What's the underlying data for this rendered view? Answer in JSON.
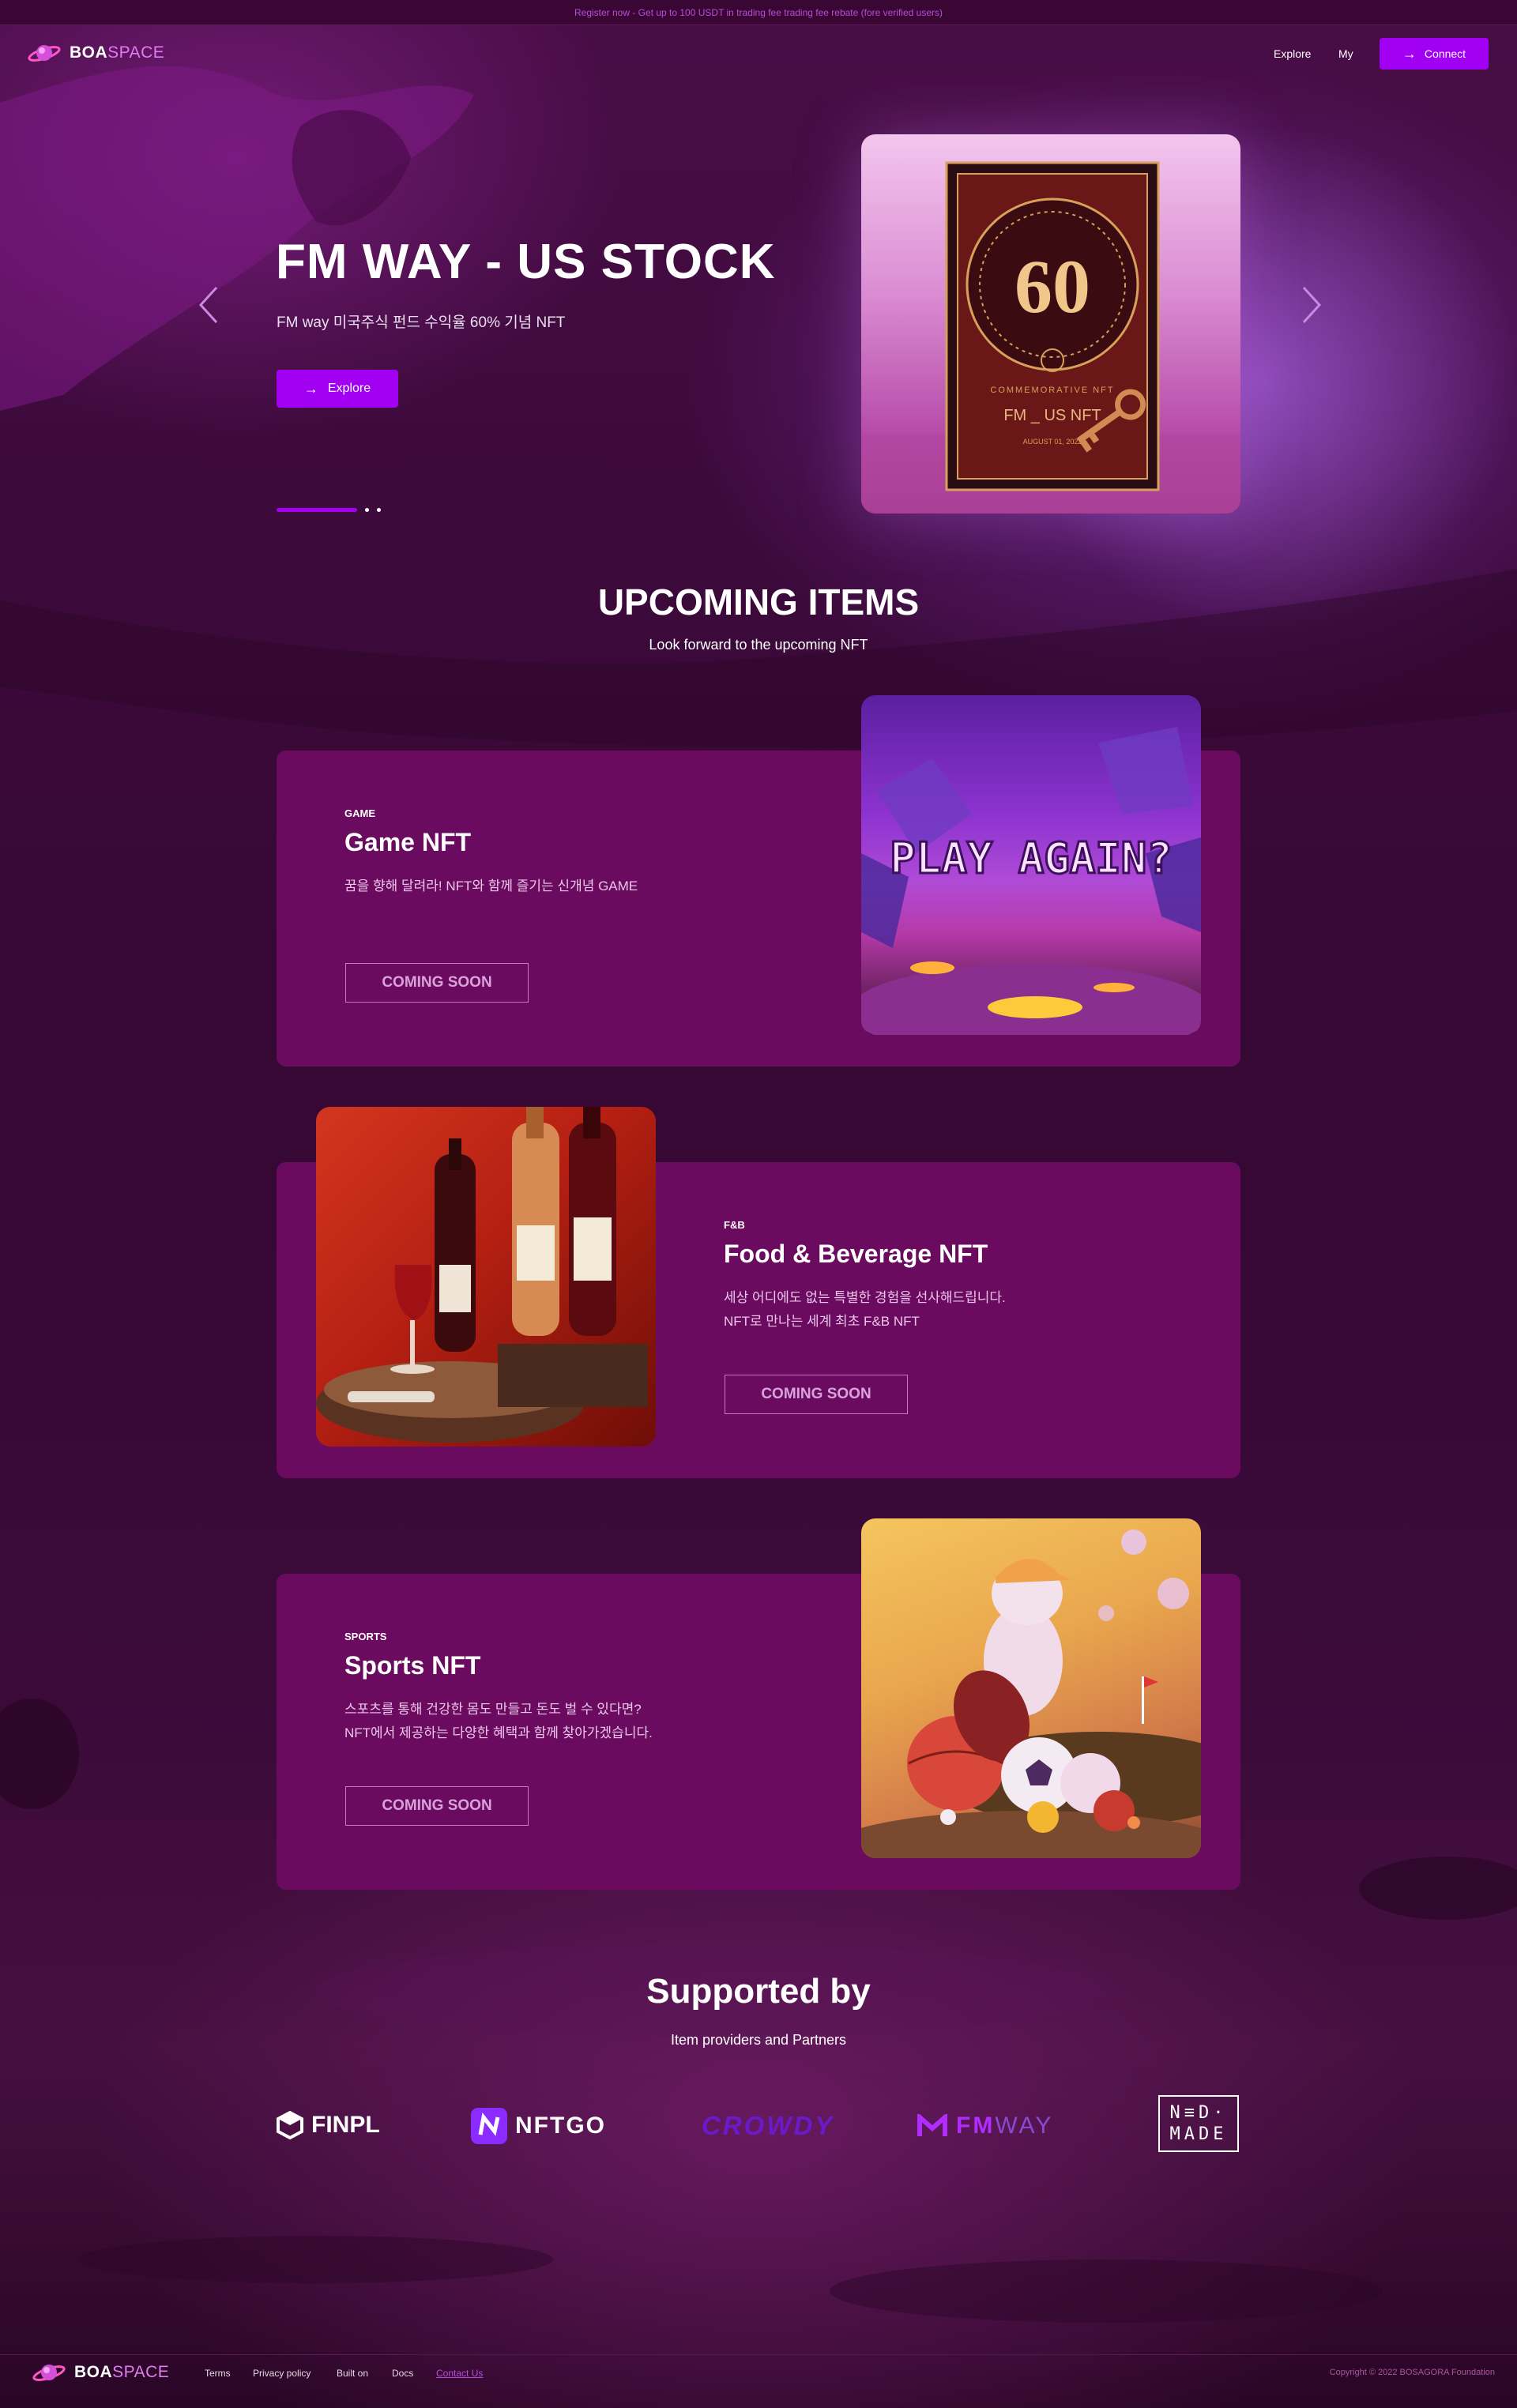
{
  "promo": {
    "text": "Register now - Get up to 100 USDT in trading fee trading fee rebate (fore verified users)"
  },
  "brand": {
    "logo_bold": "BOA",
    "logo_light": "SPACE",
    "icon": "planet-logo-icon"
  },
  "nav": {
    "explore": "Explore",
    "my": "My",
    "connect": "Connect"
  },
  "hero": {
    "title": "FM WAY - US STOCK",
    "subtitle": "FM way 미국주식 펀드 수익율 60% 기념 NFT",
    "button": "Explore",
    "card": {
      "number": "60",
      "top_label": "COMMEMORATIVE NFT",
      "name": "FM _ US NFT",
      "date": "AUGUST 01, 2022"
    },
    "slides_total": 3,
    "slide_active": 1
  },
  "upcoming": {
    "title": "UPCOMING ITEMS",
    "subtitle": "Look forward to the upcoming NFT",
    "items": [
      {
        "category": "GAME",
        "title": "Game NFT",
        "description": "꿈을 향해 달려라! NFT와 함께 즐기는 신개념 GAME",
        "button": "COMING SOON",
        "image_text": "PLAY AGAIN?"
      },
      {
        "category": "F&B",
        "title": "Food & Beverage NFT",
        "description": "세상 어디에도 없는 특별한 경험을 선사해드립니다.\nNFT로 만나는 세계 최초 F&B NFT",
        "button": "COMING SOON"
      },
      {
        "category": "SPORTS",
        "title": "Sports NFT",
        "description": "스포츠를 통해 건강한 몸도 만들고 돈도 벌 수 있다면?\nNFT에서 제공하는 다양한 혜택과 함께 찾아가겠습니다.",
        "button": "COMING SOON"
      }
    ]
  },
  "supported": {
    "title": "Supported by",
    "subtitle": "Item providers and Partners",
    "partners": [
      {
        "name": "FINPL",
        "icon": "finpl-cube-icon"
      },
      {
        "name": "NFTGO",
        "icon": "nftgo-n-icon"
      },
      {
        "name": "CROWDY"
      },
      {
        "name_a": "FM",
        "name_b": "WAY",
        "icon": "fmway-m-icon"
      },
      {
        "row1": "N≡D·",
        "row2": "MADE"
      }
    ]
  },
  "footer": {
    "logo_bold": "BOA",
    "logo_light": "SPACE",
    "links": [
      "Terms",
      "Privacy policy",
      "Built on",
      "Docs",
      "Contact Us"
    ],
    "copyright": "Copyright © 2022 BOSAGORA Foundation"
  },
  "colors": {
    "accent": "#a100f2",
    "card": "#6b0b60",
    "background": "#3d0a3c"
  }
}
